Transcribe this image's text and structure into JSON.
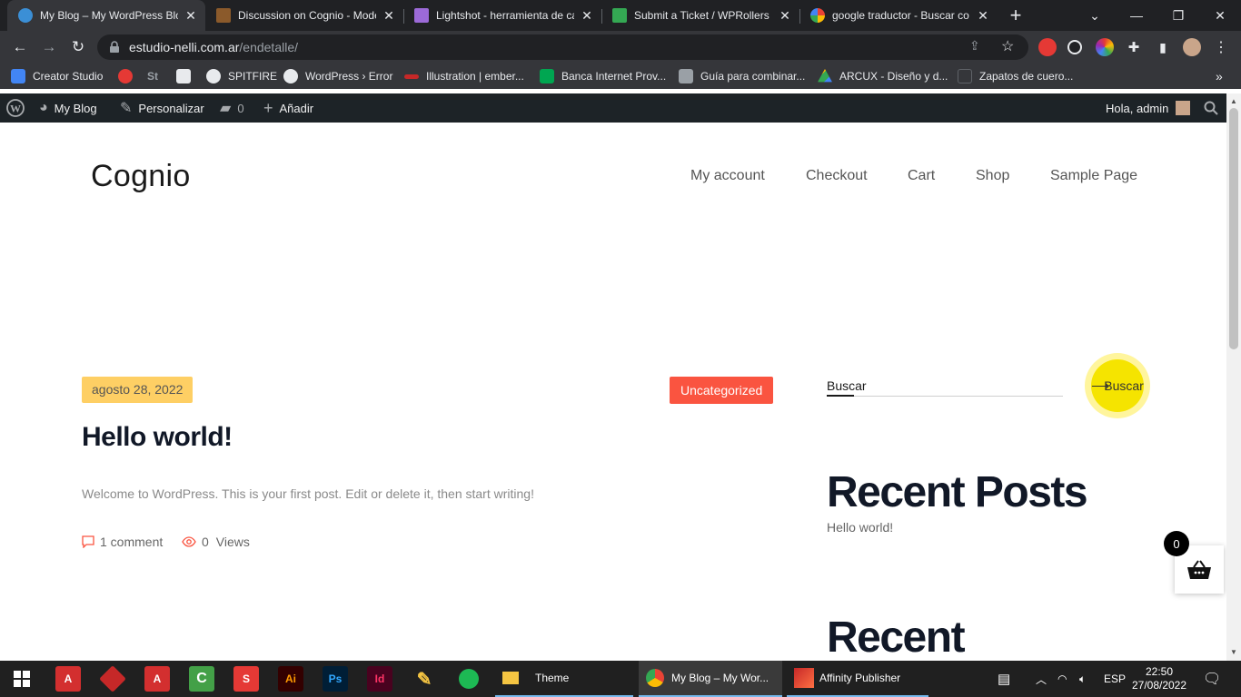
{
  "browser": {
    "tabs": [
      {
        "title": "My Blog – My WordPress Blo",
        "favicon": "wordpress-icon",
        "color": "#3b8fd6",
        "active": true
      },
      {
        "title": "Discussion on Cognio - Mode",
        "favicon": "book-icon",
        "color": "#8b5a2b",
        "active": false
      },
      {
        "title": "Lightshot - herramienta de ca",
        "favicon": "feather-icon",
        "color": "#9c6ad8",
        "active": false
      },
      {
        "title": "Submit a Ticket / WPRollers",
        "favicon": "ticket-icon",
        "color": "#34a853",
        "active": false
      },
      {
        "title": "google traductor - Buscar co",
        "favicon": "google-icon",
        "color": "#ffffff",
        "active": false
      }
    ],
    "url_host": "estudio-nelli.com.ar",
    "url_path": "/endetalle/",
    "bookmarks": [
      {
        "label": "Creator Studio",
        "icon": "grid-icon",
        "color": "#4285f4"
      },
      {
        "label": "",
        "icon": "target-icon",
        "color": "#e53935"
      },
      {
        "label": "St",
        "icon": "",
        "color": ""
      },
      {
        "label": "",
        "icon": "folder-icon",
        "color": "#e8eaed"
      },
      {
        "label": "SPITFIRE",
        "icon": "globe-icon",
        "color": "#e8eaed"
      },
      {
        "label": "WordPress › Error",
        "icon": "globe-icon",
        "color": "#e8eaed"
      },
      {
        "label": "Illustration | ember...",
        "icon": "swoosh-icon",
        "color": "#c62828"
      },
      {
        "label": "Banca Internet Prov...",
        "icon": "bank-icon",
        "color": "#00a651"
      },
      {
        "label": "Guía para combinar...",
        "icon": "crowd-icon",
        "color": "#e8eaed"
      },
      {
        "label": "ARCUX - Diseño y d...",
        "icon": "drive-icon",
        "color": "#fbbc04"
      },
      {
        "label": "Zapatos de cuero...",
        "icon": "b-icon",
        "color": "#5f6368"
      }
    ]
  },
  "adminbar": {
    "site": "My Blog",
    "customize": "Personalizar",
    "comments_count": "0",
    "add_new": "Añadir",
    "greeting": "Hola, admin"
  },
  "site": {
    "title": "Cognio",
    "nav": [
      "My account",
      "Checkout",
      "Cart",
      "Shop",
      "Sample Page"
    ]
  },
  "post": {
    "date": "agosto 28, 2022",
    "category": "Uncategorized",
    "title": "Hello world!",
    "excerpt": "Welcome to WordPress. This is your first post. Edit or delete it, then start writing!",
    "comments": "1 comment",
    "views_count": "0",
    "views_label": "Views"
  },
  "sidebar": {
    "search_placeholder": "Buscar",
    "search_button": "Buscar",
    "recent_posts_title": "Recent Posts",
    "recent_posts": [
      "Hello world!"
    ],
    "recent_2_title": "Recent"
  },
  "cart": {
    "count": "0"
  },
  "taskbar": {
    "apps": [
      {
        "label": "Theme",
        "icon": "folder-icon"
      },
      {
        "label": "My Blog – My Wor...",
        "icon": "chrome-icon"
      },
      {
        "label": "Affinity Publisher",
        "icon": "affinity-publisher-icon"
      }
    ],
    "pinned": [
      {
        "icon": "autocad-icon",
        "text": "",
        "color": "#d32f2f"
      },
      {
        "icon": "gem-icon",
        "text": "",
        "color": "#c62828"
      },
      {
        "icon": "autocad-icon",
        "text": "",
        "color": "#d32f2f"
      },
      {
        "icon": "camtasia-icon",
        "text": "",
        "color": "#43a047"
      },
      {
        "icon": "sketchup-icon",
        "text": "",
        "color": "#e53935"
      },
      {
        "icon": "illustrator-icon",
        "text": "Ai",
        "color": "#ff9a00"
      },
      {
        "icon": "photoshop-icon",
        "text": "Ps",
        "color": "#31a8ff"
      },
      {
        "icon": "indesign-icon",
        "text": "Id",
        "color": "#ff3366"
      },
      {
        "icon": "pencil-icon",
        "text": "",
        "color": "#f5c542"
      },
      {
        "icon": "spotify-icon",
        "text": "",
        "color": "#1db954"
      }
    ],
    "language": "ESP",
    "time": "22:50",
    "date": "27/08/2022"
  }
}
